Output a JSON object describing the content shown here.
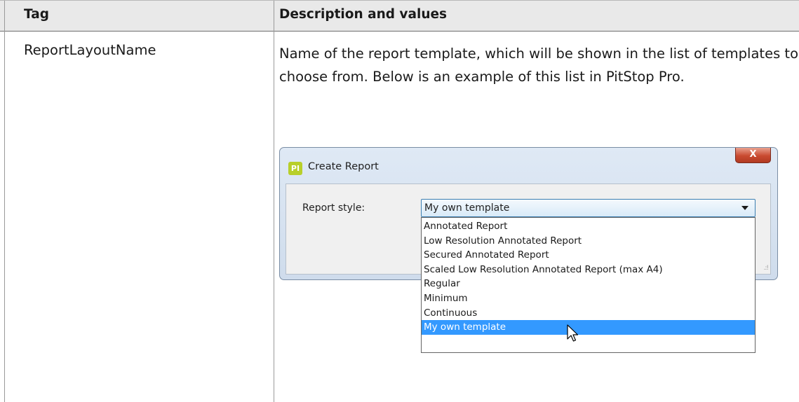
{
  "table": {
    "headers": {
      "tag": "Tag",
      "description": "Description and values"
    },
    "rows": [
      {
        "tag": "ReportLayoutName",
        "description": "Name of the report template, which will be shown in the list of templates to choose from. Below is an example of this list in PitStop Pro."
      }
    ]
  },
  "dialog": {
    "app_icon_text": "PI",
    "title": "Create Report",
    "close_label": "X",
    "report_style_label": "Report style:",
    "selected_value": "My own template",
    "options": [
      "Annotated Report",
      "Low Resolution Annotated Report",
      "Secured Annotated Report",
      "Scaled Low Resolution Annotated Report (max A4)",
      "Regular",
      "Minimum",
      "Continuous",
      "My own template"
    ],
    "highlighted_option_index": 7,
    "icons": [
      "pitstop-app-icon",
      "close-icon",
      "dropdown-arrow-icon",
      "mouse-pointer-icon"
    ]
  },
  "colors": {
    "header_bg": "#e9e9e9",
    "selection": "#3399ff",
    "close_button": "#c94a30",
    "app_icon": "#b8cf2a"
  }
}
